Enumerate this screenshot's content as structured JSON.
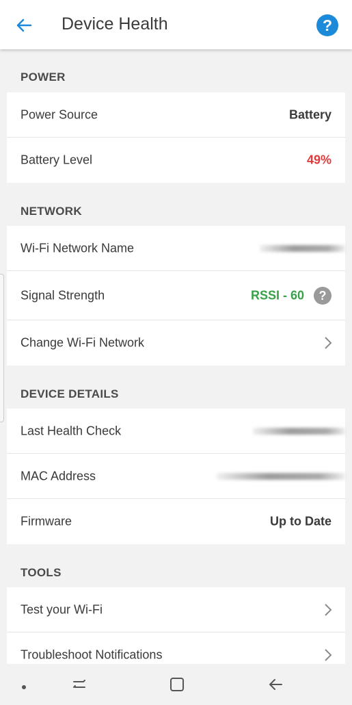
{
  "header": {
    "title": "Device Health",
    "help_label": "?"
  },
  "sections": {
    "power": {
      "title": "POWER",
      "power_source_label": "Power Source",
      "power_source_value": "Battery",
      "battery_level_label": "Battery Level",
      "battery_level_value": "49%"
    },
    "network": {
      "title": "NETWORK",
      "wifi_name_label": "Wi-Fi Network Name",
      "signal_label": "Signal Strength",
      "signal_value": "RSSI - 60",
      "signal_help": "?",
      "change_wifi_label": "Change Wi-Fi Network"
    },
    "device_details": {
      "title": "DEVICE DETAILS",
      "last_check_label": "Last Health Check",
      "mac_label": "MAC Address",
      "firmware_label": "Firmware",
      "firmware_value": "Up to Date"
    },
    "tools": {
      "title": "TOOLS",
      "test_wifi_label": "Test your Wi-Fi",
      "troubleshoot_label": "Troubleshoot Notifications"
    }
  },
  "colors": {
    "accent": "#1c8ad9",
    "battery_red": "#e03a3a",
    "signal_green": "#3aa14a"
  },
  "icons": [
    "back-arrow-icon",
    "help-icon",
    "chevron-right-icon",
    "dot-icon",
    "recent-apps-icon",
    "home-icon",
    "system-back-icon"
  ]
}
